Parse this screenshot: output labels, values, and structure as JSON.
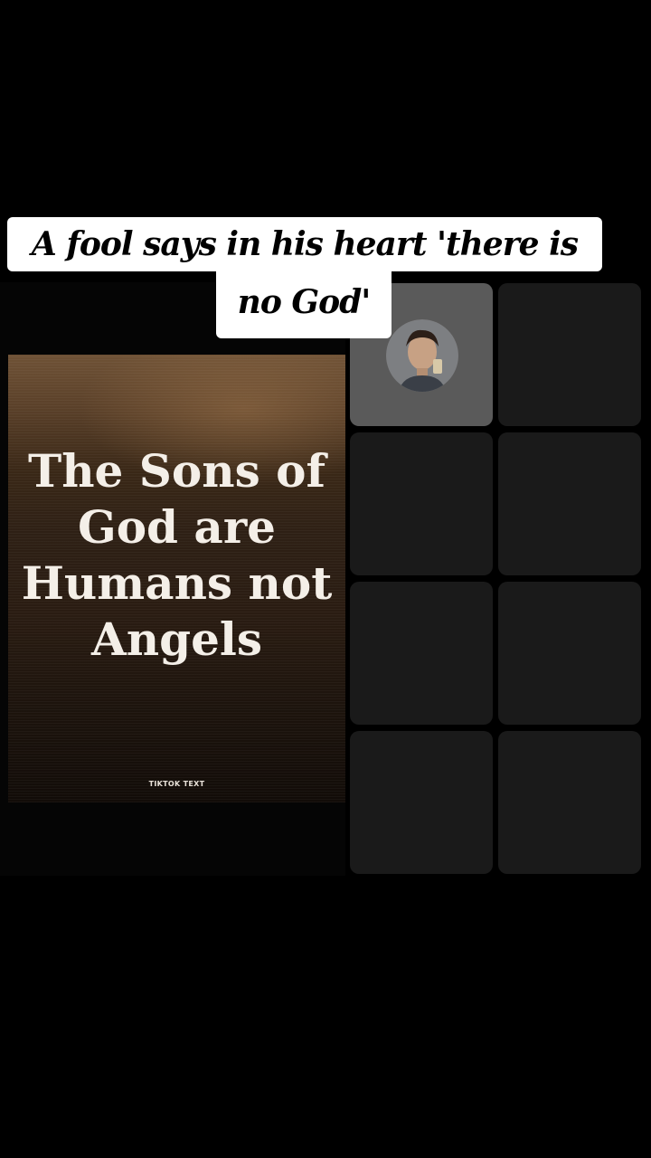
{
  "caption": {
    "line1": "A fool says in his heart 'there is",
    "line2": "no God'"
  },
  "video": {
    "title_lines": [
      "The Sons of",
      "God are",
      "Humans not",
      "Angels"
    ],
    "watermark": "TIKTOK TEXT"
  },
  "grid": {
    "tiles": [
      {
        "name": "tile-1",
        "active": true,
        "avatar": "user-avatar"
      },
      {
        "name": "tile-2"
      },
      {
        "name": "tile-3"
      },
      {
        "name": "tile-4"
      },
      {
        "name": "tile-5"
      },
      {
        "name": "tile-6"
      },
      {
        "name": "tile-7"
      },
      {
        "name": "tile-8"
      }
    ]
  }
}
